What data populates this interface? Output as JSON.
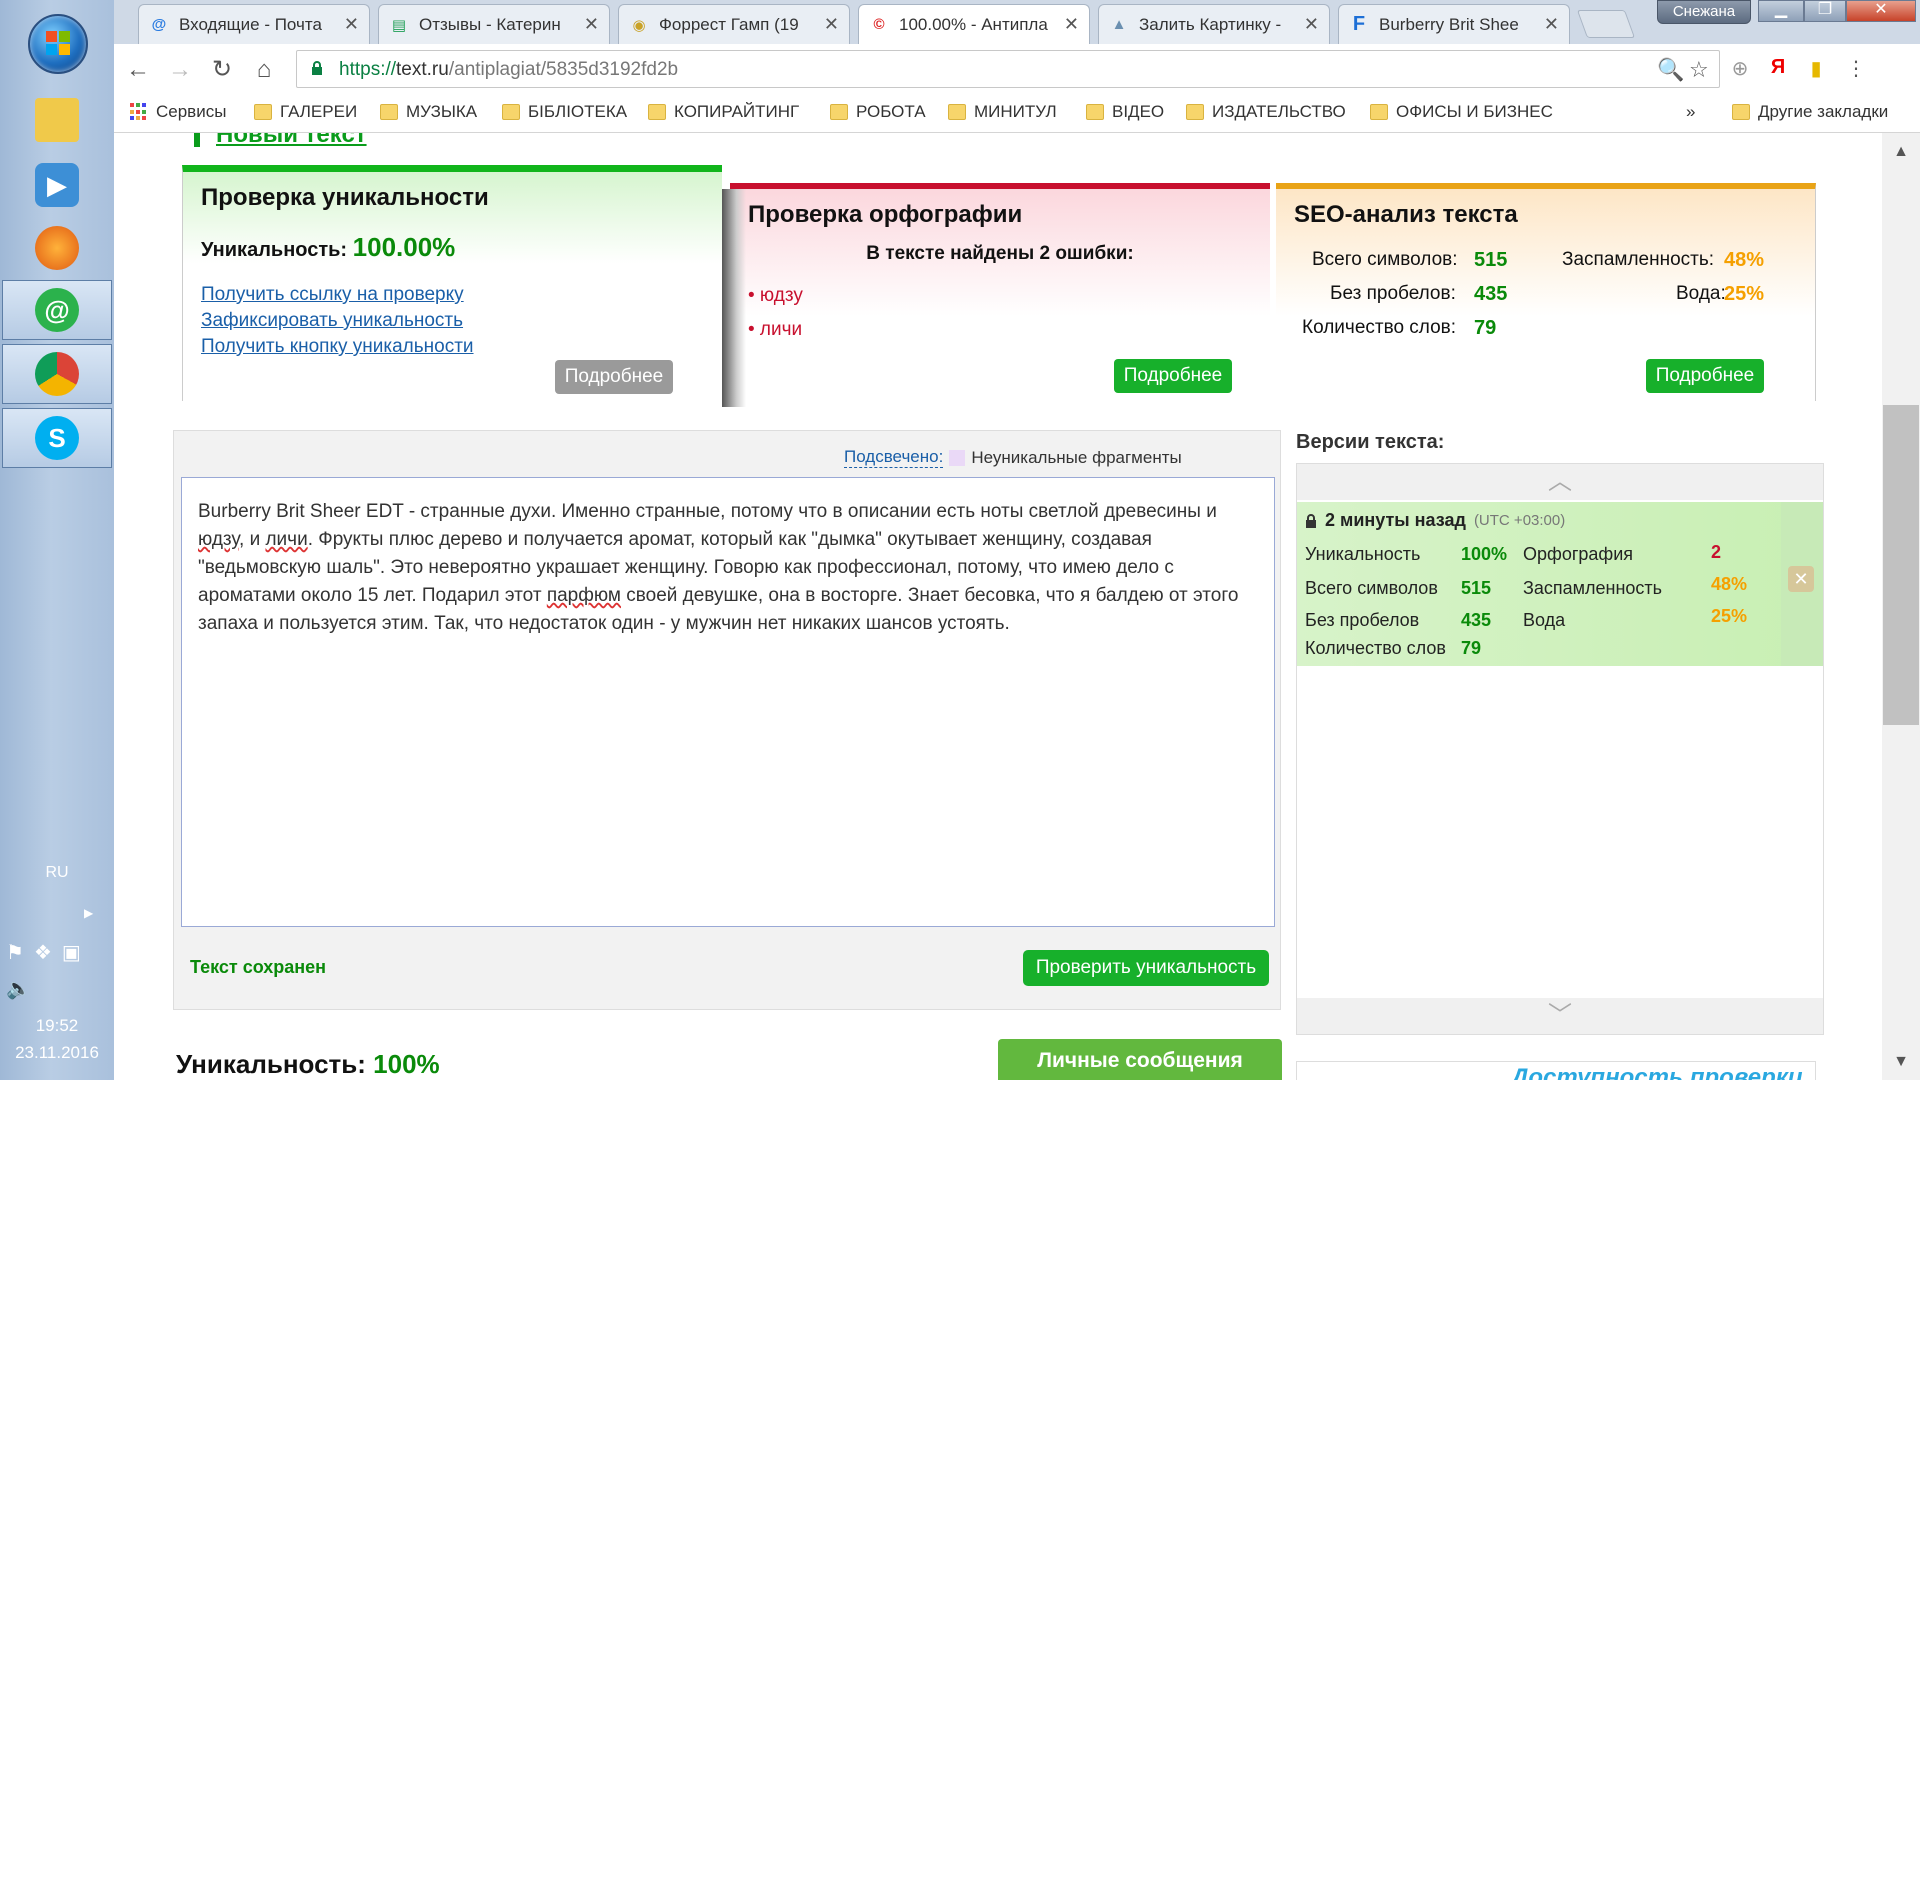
{
  "taskbar": {
    "lang": "RU",
    "time": "19:52",
    "date": "23.11.2016"
  },
  "browser": {
    "tabs": [
      {
        "title": "Входящие - Почта",
        "favicon": "mail-icon"
      },
      {
        "title": "Отзывы - Катерин",
        "favicon": "sheets-icon"
      },
      {
        "title": "Форрест Гамп (19",
        "favicon": "film-icon"
      },
      {
        "title": "100.00% - Антипла",
        "favicon": "textru-icon"
      },
      {
        "title": "Залить Картинку -",
        "favicon": "image-icon"
      },
      {
        "title": "Burberry Brit Shee",
        "favicon": "fragrance-icon"
      }
    ],
    "user": "Снежана",
    "url_scheme": "https://",
    "url_host": "text.ru",
    "url_path": "/antiplagiat/5835d3192fd2b"
  },
  "bookmarks": {
    "apps": "Сервисы",
    "items": [
      "ГАЛЕРЕИ",
      "МУЗЫКА",
      "БІБЛІОТЕКА",
      "КОПИРАЙТИНГ",
      "РОБОТА",
      "МИНИТУЛ",
      "ВІДЕО",
      "ИЗДАТЕЛЬСТВО",
      "ОФИСЫ И БИЗНЕС"
    ],
    "more": "»",
    "other": "Другие закладки"
  },
  "page": {
    "new_text_link": "Новый текст",
    "uniqueness_panel": {
      "title": "Проверка уникальности",
      "label": "Уникальность:",
      "value": "100.00%",
      "links": [
        "Получить ссылку на проверку",
        "Зафиксировать уникальность",
        "Получить кнопку уникальности"
      ],
      "button": "Подробнее"
    },
    "spelling_panel": {
      "title": "Проверка орфографии",
      "found": "В тексте найдены 2 ошибки:",
      "errors": [
        "• юдзу",
        "• личи"
      ],
      "button": "Подробнее"
    },
    "seo_panel": {
      "title": "SEO-анализ текста",
      "chars_label": "Всего символов:",
      "chars": "515",
      "nospace_label": "Без пробелов:",
      "nospace": "435",
      "words_label": "Количество слов:",
      "words": "79",
      "spam_label": "Заспамленность:",
      "spam": "48%",
      "water_label": "Вода:",
      "water": "25%",
      "button": "Подробнее"
    },
    "editor": {
      "highlight_link": "Подсвечено:",
      "highlight_desc": "Неуникальные фрагменты",
      "text_before_1": "Burberry Brit Sheer EDT - странные духи. Именно странные, потому что в описании есть ноты светлой древесины и ",
      "misspell_1": "юдзу",
      "text_between_1": ", и ",
      "misspell_2": "личи",
      "text_between_2": ". Фрукты плюс дерево и получается аромат, который как \"дымка\" окутывает женщину, создавая \"ведьмовскую шаль\". Это невероятно украшает женщину. Говорю как профессионал, потому, что имею дело с ароматами около 15 лет. Подарил этот ",
      "misspell_3": "парфюм",
      "text_after": " своей девушке, она в восторге. Знает бесовка, что я балдею от этого запаха и пользуется этим. Так, что недостаток один - у мужчин нет никаких шансов устоять.",
      "saved": "Текст сохранен",
      "check_button": "Проверить уникальность"
    },
    "bottom": {
      "uniq_label": "Уникальность:",
      "uniq_value": "100%",
      "messages_button": "Личные сообщения",
      "availability_banner": "Доступность проверки"
    },
    "versions": {
      "title": "Версии текста:",
      "item": {
        "time": "2 минуты назад",
        "tz": "(UTC +03:00)",
        "uniq_label": "Уникальность",
        "uniq": "100%",
        "spell_label": "Орфография",
        "spell": "2",
        "chars_label": "Всего символов",
        "chars": "515",
        "spam_label": "Заспамленность",
        "spam": "48%",
        "nospace_label": "Без пробелов",
        "nospace": "435",
        "water_label": "Вода",
        "water": "25%",
        "words_label": "Количество слов",
        "words": "79"
      }
    }
  },
  "colors": {
    "green": "#17b02b",
    "red": "#c8102e",
    "orange": "#f5a000"
  }
}
